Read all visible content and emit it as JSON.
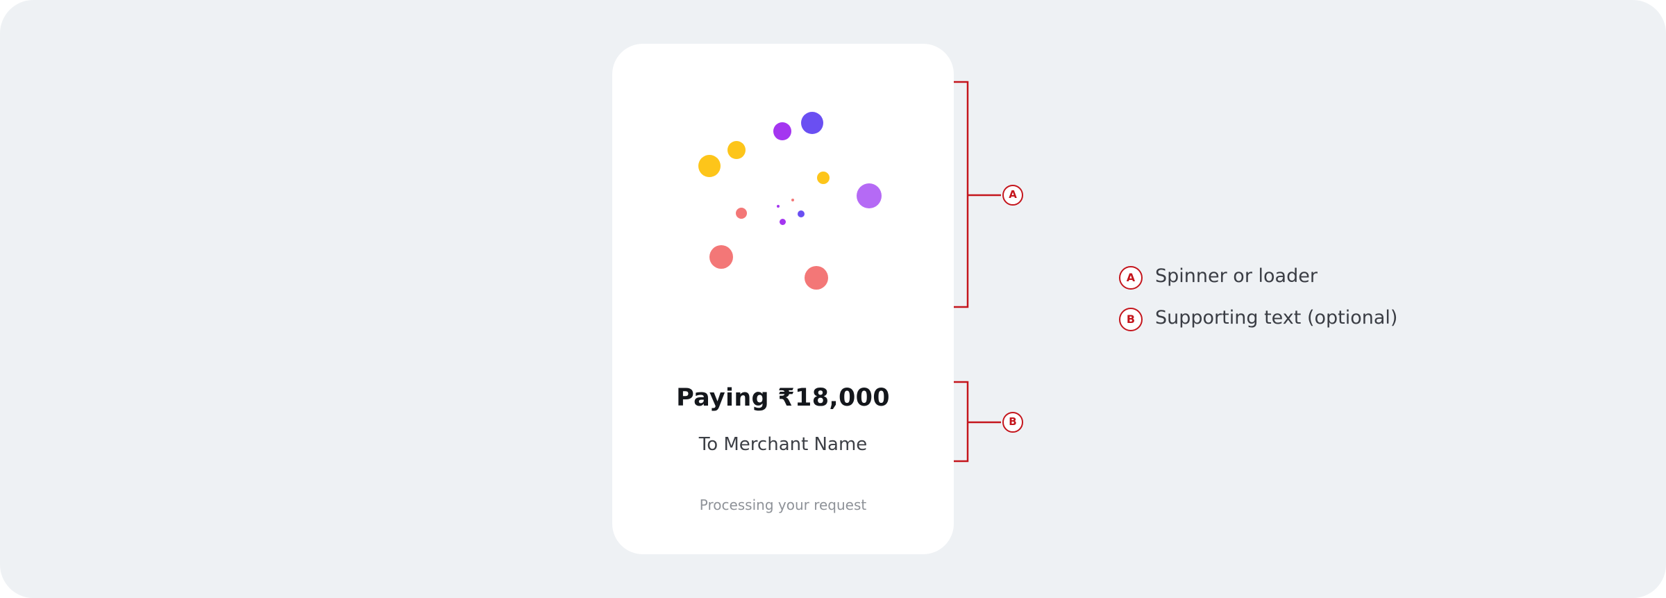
{
  "card": {
    "title": "Paying ₹18,000",
    "subtitle": "To Merchant Name",
    "status": "Processing your request"
  },
  "spinner": {
    "colors": {
      "yellow": "#fdc51a",
      "purple": "#a435f0",
      "indigo": "#6a4ff2",
      "lavender": "#b56af5",
      "coral": "#f37777"
    }
  },
  "annotations": {
    "marker_a": "A",
    "marker_b": "B"
  },
  "legend": {
    "items": [
      {
        "marker": "A",
        "label": "Spinner or loader"
      },
      {
        "marker": "B",
        "label": "Supporting text (optional)"
      }
    ]
  },
  "theme": {
    "annotation_red": "#c4151c",
    "canvas_bg": "#eef1f4"
  }
}
